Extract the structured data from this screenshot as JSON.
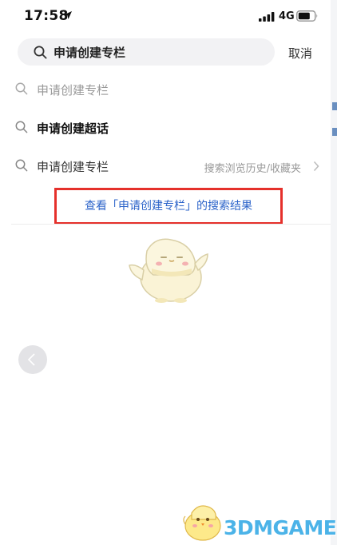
{
  "status_bar": {
    "time": "17:58",
    "network": "4G",
    "icons": [
      "location-arrow-icon",
      "signal-bars-icon",
      "battery-icon"
    ]
  },
  "search": {
    "query": "申请创建专栏",
    "cancel_label": "取消",
    "icon": "search-icon"
  },
  "suggestions": [
    {
      "label": "申请创建专栏",
      "style": "muted",
      "icon": "search-icon"
    },
    {
      "label": "申请创建超话",
      "style": "strong",
      "icon": "search-icon"
    },
    {
      "label": "申请创建专栏",
      "style": "normal",
      "icon": "search-icon",
      "hint": "搜索浏览历史/收藏夹",
      "trailing_icon": "chevron-right-icon"
    }
  ],
  "result_link": {
    "label": "查看「申请创建专栏」的搜索结果",
    "color": "#2b63c9",
    "highlight_color": "#e5302b"
  },
  "mascot": {
    "icon": "chick-mascot-icon"
  },
  "back_button": {
    "icon": "chevron-left-icon"
  },
  "watermark": {
    "text": "3DMGAME",
    "color": "#4bb3e8"
  }
}
